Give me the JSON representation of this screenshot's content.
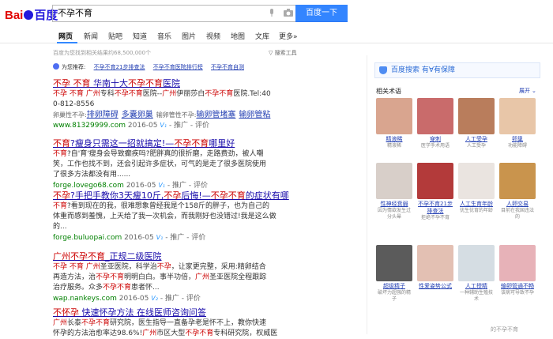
{
  "header": {
    "logo_red": "Bai",
    "logo_blue": "百度",
    "query": "不孕不育",
    "search_button": "百度一下"
  },
  "nav": {
    "items": [
      "网页",
      "新闻",
      "贴吧",
      "知道",
      "音乐",
      "图片",
      "视频",
      "地图",
      "文库",
      "更多»"
    ]
  },
  "results_info": "百度为您找到相关结果约68,500,000个",
  "search_tools": "搜索工具",
  "recommend": {
    "label": "为您推荐:",
    "links": [
      "不孕不育21步排查法",
      "不孕不育医院排行榜",
      "不孕不育自测"
    ]
  },
  "results": [
    {
      "title_parts": [
        [
          "red",
          "不孕 不育"
        ],
        [
          "",
          " 华南十大"
        ],
        [
          "red",
          "不孕不育"
        ],
        [
          "",
          "医院"
        ]
      ],
      "body": [
        [
          [
            "red",
            "不孕 不育 广州"
          ],
          [
            "",
            "专科"
          ],
          [
            "red",
            "不孕不育"
          ],
          [
            "",
            "医院--"
          ],
          [
            "red",
            "广州"
          ],
          [
            "",
            "伊丽莎白"
          ],
          [
            "red",
            "不孕不育"
          ],
          [
            "",
            "医院.Tel:40"
          ]
        ],
        [
          [
            "",
            "0-812-8556"
          ]
        ]
      ],
      "sublinks": [
        {
          "label": "卵巢性不孕:",
          "links": [
            "排卵障碍",
            "多囊卵巢"
          ]
        },
        {
          "label": "输卵管性不孕:",
          "links": [
            "输卵管堵塞",
            "输卵管粘"
          ]
        }
      ],
      "url": "www.81329999.com",
      "date": "2016-05",
      "v": "V₁",
      "extra": "- 推广 - 评价"
    },
    {
      "title_parts": [
        [
          "red",
          "不育"
        ],
        [
          "",
          "?瘦身只需这一招就搞定!—"
        ],
        [
          "red",
          "不孕不育"
        ],
        [
          "",
          "哪里好"
        ]
      ],
      "body": [
        [
          [
            "red",
            "不育"
          ],
          [
            "",
            "?自'育'瘦身会导致癫疾吗?肥胖真的很折磨，走路费劲，被人嘲"
          ]
        ],
        [
          [
            "",
            "笑，工作也找不到，还会引起许多症状，可气的是走了很多医院使用"
          ]
        ],
        [
          [
            "",
            "了很多方法都没有用......"
          ]
        ]
      ],
      "url": "forge.lovego68.com",
      "date": "2016-05",
      "v": "V₁",
      "extra": "- 推广 - 评价"
    },
    {
      "title_parts": [
        [
          "red",
          "不孕"
        ],
        [
          "",
          "?手把手教你3天瘦10斤,"
        ],
        [
          "red",
          "不孕"
        ],
        [
          "",
          "后悔!—"
        ],
        [
          "red",
          "不孕不育"
        ],
        [
          "",
          "的症状有哪"
        ]
      ],
      "body": [
        [
          [
            "red",
            "不育"
          ],
          [
            "",
            "?看到现在的我，很难想象曾经我是个158斤的胖子，也为自己的"
          ]
        ],
        [
          [
            "",
            "体重而感到羞愧，上天给了我一次机会，而我刚好也没错过!我是这么做"
          ]
        ],
        [
          [
            "",
            "的..."
          ]
        ]
      ],
      "url": "forge.buluopai.com",
      "date": "2016-05",
      "v": "V₁",
      "extra": "- 推广 - 评价"
    },
    {
      "title_parts": [
        [
          "red",
          "广州不孕不育"
        ],
        [
          "",
          "_正规二级医院"
        ]
      ],
      "body": [
        [
          [
            "red",
            "不孕 不育 广州"
          ],
          [
            "",
            "圣亚医院，科学治"
          ],
          [
            "red",
            "不孕"
          ],
          [
            "",
            "，让家更完整，采用:精卵结合"
          ]
        ],
        [
          [
            "",
            "再造方法，治"
          ],
          [
            "red",
            "不孕不育"
          ],
          [
            "",
            "明明白白。事半功倍，"
          ],
          [
            "red",
            "广州"
          ],
          [
            "",
            "圣亚医院全程跟踪"
          ]
        ],
        [
          [
            "",
            "治疗服务。众多"
          ],
          [
            "red",
            "不孕不育"
          ],
          [
            "",
            "患者怀..."
          ]
        ]
      ],
      "url": "wap.nankeys.com",
      "date": "2016-05",
      "v": "V₂",
      "extra": "- 推广 - 评价"
    },
    {
      "title_parts": [
        [
          "red",
          "不怀孕"
        ],
        [
          "",
          " 快速怀孕方法 在线医师咨询问答"
        ]
      ],
      "body": [
        [
          [
            "red",
            "广州"
          ],
          [
            "",
            "长泰"
          ],
          [
            "red",
            "不孕不育"
          ],
          [
            "",
            "研究院，医生指导一直备孕老是怀不上，教你快速"
          ]
        ],
        [
          [
            "",
            "怀孕的方法治愈率达98.6%!"
          ],
          [
            "red",
            "广州"
          ],
          [
            "",
            "市区大型"
          ],
          [
            "red",
            "不孕不育"
          ],
          [
            "",
            "专科研究院，权威医"
          ]
        ]
      ],
      "url": "",
      "date": "",
      "v": "",
      "extra": ""
    }
  ],
  "sidebar": {
    "baozhang": "百度搜索 有∀有保障",
    "related_title": "相关术语",
    "expand": "展开",
    "items": [
      {
        "label": "精液稀",
        "desc": "精液稀",
        "color": "#d9a58f"
      },
      {
        "label": "穿刺",
        "desc": "医学手术用语",
        "color": "#c96b6b"
      },
      {
        "label": "人工受孕",
        "desc": "人工受孕",
        "color": "#b97d5c"
      },
      {
        "label": "卵巢",
        "desc": "功能障碍",
        "color": "#e8c6a8"
      },
      {
        "label": "性神经衰弱",
        "desc": "因为情欲发生过分头晕",
        "color": "#d8cfc9"
      },
      {
        "label": "不孕不育21步排查法",
        "desc": "拒绝不孕不育",
        "color": "#b33a3a"
      },
      {
        "label": "人工生育年龄",
        "desc": "优生优育的年龄",
        "color": "#eae4e0"
      },
      {
        "label": "人卵交易",
        "desc": "目前在我国违法的",
        "color": "#c9944d"
      },
      {
        "label": "超级精子",
        "desc": "破坏力超强的精子",
        "color": "#5b5b5b"
      },
      {
        "label": "性爱姿势公式",
        "desc": "",
        "color": "#e3c0b3"
      },
      {
        "label": "人工授精",
        "desc": "一种辅助生殖技术",
        "color": "#d5dde3"
      },
      {
        "label": "输卵管通不畅",
        "desc": "该病可导致不孕",
        "color": "#e7b2b8"
      }
    ],
    "bottom_text": "的不孕不育"
  }
}
